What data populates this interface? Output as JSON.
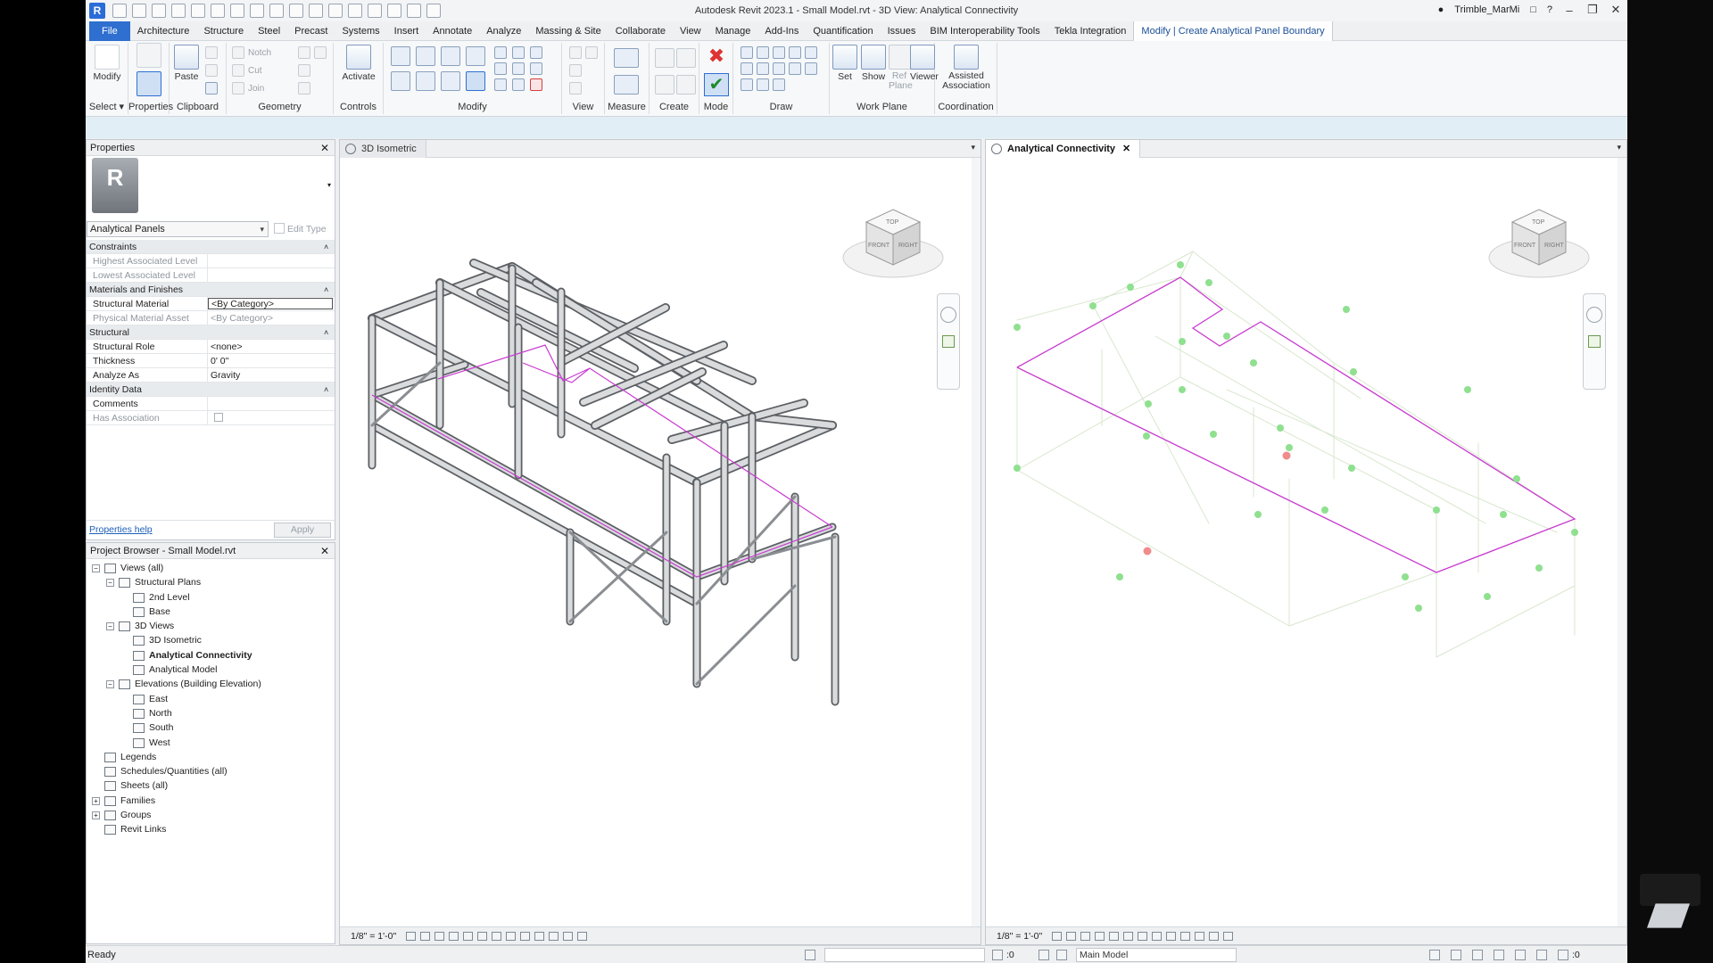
{
  "app": {
    "title": "Autodesk Revit 2023.1 - Small Model.rvt - 3D View: Analytical Connectivity",
    "user": "Trimble_MarMi",
    "logo": "R"
  },
  "menu": [
    "File",
    "Architecture",
    "Structure",
    "Steel",
    "Precast",
    "Systems",
    "Insert",
    "Annotate",
    "Analyze",
    "Massing & Site",
    "Collaborate",
    "View",
    "Manage",
    "Add-Ins",
    "Quantification",
    "Issues",
    "BIM Interoperability Tools",
    "Tekla Integration",
    "Modify | Create Analytical Panel Boundary"
  ],
  "ribbon": {
    "modify": "Modify",
    "select": "Select",
    "properties": "Properties",
    "paste": "Paste",
    "clipboard": "Clipboard",
    "notch": "Notch",
    "cut": "Cut",
    "join": "Join",
    "geometry": "Geometry",
    "activate": "Activate",
    "controls": "Controls",
    "modify_panel": "Modify",
    "view": "View",
    "measure": "Measure",
    "create": "Create",
    "mode": "Mode",
    "draw": "Draw",
    "set": "Set",
    "show": "Show",
    "ref_plane": "Ref Plane",
    "viewer": "Viewer",
    "work_plane": "Work Plane",
    "assisted_association": "Assisted Association",
    "coordination": "Coordination"
  },
  "properties": {
    "title": "Properties",
    "type_name": "Analytical Panels",
    "edit_type": "Edit Type",
    "groups": [
      {
        "name": "Constraints",
        "rows": [
          {
            "k": "Highest Associated Level",
            "v": "",
            "dim": true
          },
          {
            "k": "Lowest Associated Level",
            "v": "",
            "dim": true
          }
        ]
      },
      {
        "name": "Materials and Finishes",
        "rows": [
          {
            "k": "Structural Material",
            "v": "<By Category>",
            "dim": false,
            "edit": true
          },
          {
            "k": "Physical Material Asset",
            "v": "<By Category>",
            "dim": true
          }
        ]
      },
      {
        "name": "Structural",
        "rows": [
          {
            "k": "Structural Role",
            "v": "<none>",
            "dim": false
          },
          {
            "k": "Thickness",
            "v": "0' 0\"",
            "dim": false
          },
          {
            "k": "Analyze As",
            "v": "Gravity",
            "dim": false
          }
        ]
      },
      {
        "name": "Identity Data",
        "rows": [
          {
            "k": "Comments",
            "v": "",
            "dim": false
          },
          {
            "k": "Has Association",
            "v": "",
            "dim": true,
            "checkbox": true
          }
        ]
      }
    ],
    "help": "Properties help",
    "apply": "Apply"
  },
  "browser": {
    "title": "Project Browser - Small Model.rvt",
    "nodes": [
      {
        "label": "Views (all)",
        "level": 0,
        "toggle": "-"
      },
      {
        "label": "Structural Plans",
        "level": 1,
        "toggle": "-"
      },
      {
        "label": "2nd Level",
        "level": 2
      },
      {
        "label": "Base",
        "level": 2
      },
      {
        "label": "3D Views",
        "level": 1,
        "toggle": "-"
      },
      {
        "label": "3D Isometric",
        "level": 2
      },
      {
        "label": "Analytical Connectivity",
        "level": 2,
        "bold": true
      },
      {
        "label": "Analytical Model",
        "level": 2
      },
      {
        "label": "Elevations (Building Elevation)",
        "level": 1,
        "toggle": "-"
      },
      {
        "label": "East",
        "level": 2
      },
      {
        "label": "North",
        "level": 2
      },
      {
        "label": "South",
        "level": 2
      },
      {
        "label": "West",
        "level": 2
      },
      {
        "label": "Legends",
        "level": 0
      },
      {
        "label": "Schedules/Quantities (all)",
        "level": 0
      },
      {
        "label": "Sheets (all)",
        "level": 0
      },
      {
        "label": "Families",
        "level": 0,
        "toggle": "+"
      },
      {
        "label": "Groups",
        "level": 0,
        "toggle": "+"
      },
      {
        "label": "Revit Links",
        "level": 0
      }
    ]
  },
  "views": {
    "left_tab": "3D Isometric",
    "right_tab": "Analytical Connectivity",
    "scale_left": "1/8\" = 1'-0\"",
    "scale_right": "1/8\" = 1'-0\"",
    "cube_top": "TOP",
    "cube_front": "FRONT",
    "cube_right": "RIGHT"
  },
  "status": {
    "ready": "Ready",
    "model": "Main Model",
    "count_a": ":0",
    "count_b": ":0"
  },
  "colors": {
    "accent": "#2f6fcf",
    "boundary": "#c83bd0",
    "node": "#8fe08f",
    "node_error": "#f08c8c"
  }
}
